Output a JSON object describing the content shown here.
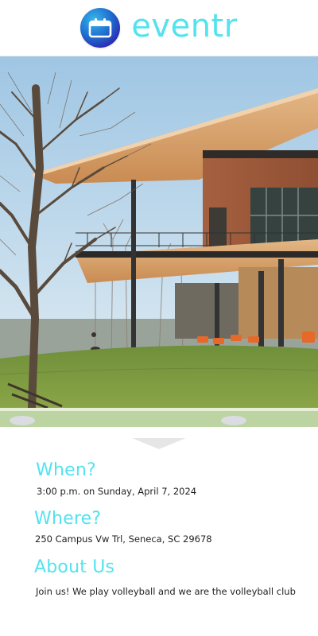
{
  "app": {
    "brand_name": "eventr",
    "brand_color": "#52e3ee",
    "logo_icon": "calendar-icon"
  },
  "event": {
    "hero_image": "building-lawn-photo",
    "when": {
      "heading": "When?",
      "value": "3:00 p.m. on Sunday, April 7, 2024"
    },
    "where": {
      "heading": "Where?",
      "value": "250 Campus Vw Trl, Seneca, SC 29678"
    },
    "about": {
      "heading": "About Us",
      "value": "Join us! We play volleyball and we are the volleyball club"
    }
  },
  "icons": {
    "divider": "chevron-down-icon"
  }
}
